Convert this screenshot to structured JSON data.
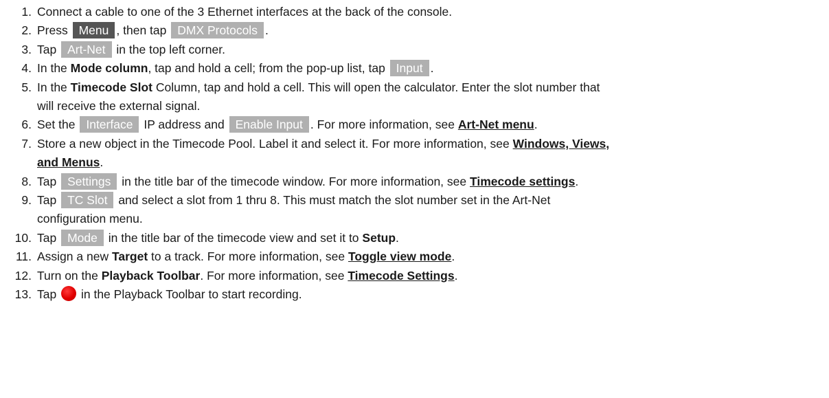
{
  "steps": [
    {
      "n": "1.",
      "t": "Connect a cable to one of the 3 Ethernet interfaces at the back of the console."
    },
    {
      "n": "2.",
      "a": "Press",
      "btn1": "Menu",
      "b": ", then tap",
      "btn2": "DMX Protocols",
      "c": "."
    },
    {
      "n": "3.",
      "a": "Tap",
      "btn1": "Art-Net",
      "b": "in the top left corner."
    },
    {
      "n": "4.",
      "a": "In the",
      "bold1": "Mode column",
      "b": ", tap and hold a cell; from the pop-up list, tap",
      "btn1": "Input",
      "c": "."
    },
    {
      "n": "5.",
      "a": "In the",
      "bold1": "Timecode Slot",
      "b": "Column, tap and hold a cell. This will open the calculator. Enter the slot number that",
      "l2": "will receive the external signal."
    },
    {
      "n": "6.",
      "a": "Set the",
      "btn1": "Interface",
      "b": "IP address and",
      "btn2": "Enable Input",
      "c": ". For more information, see",
      "link1": "Art-Net menu",
      "d": "."
    },
    {
      "n": "7.",
      "a": "Store a new object in the Timecode Pool. Label it and select it. For more information, see",
      "link1a": "Windows, Views,",
      "link1b": "and Menus",
      "d": "."
    },
    {
      "n": "8.",
      "a": "Tap",
      "btn1": "Settings",
      "b": "in the title bar of the timecode window. For more information, see",
      "link1": "Timecode settings",
      "c": "."
    },
    {
      "n": "9.",
      "a": "Tap",
      "btn1": "TC Slot",
      "b": "and select a slot from 1 thru 8. This must match the slot number set in the Art-Net",
      "l2": "configuration menu."
    },
    {
      "n": "10.",
      "a": "Tap",
      "btn1": "Mode",
      "b": "in the title bar of the timecode view and set it to",
      "bold1": "Setup",
      "c": "."
    },
    {
      "n": "11.",
      "a": "Assign a new",
      "bold1": "Target",
      "b": "to a track. For more information, see",
      "link1": "Toggle view mode",
      "c": "."
    },
    {
      "n": "12.",
      "a": "Turn on the",
      "bold1": "Playback Toolbar",
      "b": ". For more information, see",
      "link1": "Timecode Settings",
      "c": "."
    },
    {
      "n": "13.",
      "a": "Tap",
      "icon": "record-icon",
      "b": "in the Playback Toolbar to start recording."
    }
  ],
  "colors": {
    "button_bg": "#b0b0b0",
    "menu_button_bg": "#555555",
    "button_text": "#ffffff",
    "record_red": "#e00000"
  }
}
